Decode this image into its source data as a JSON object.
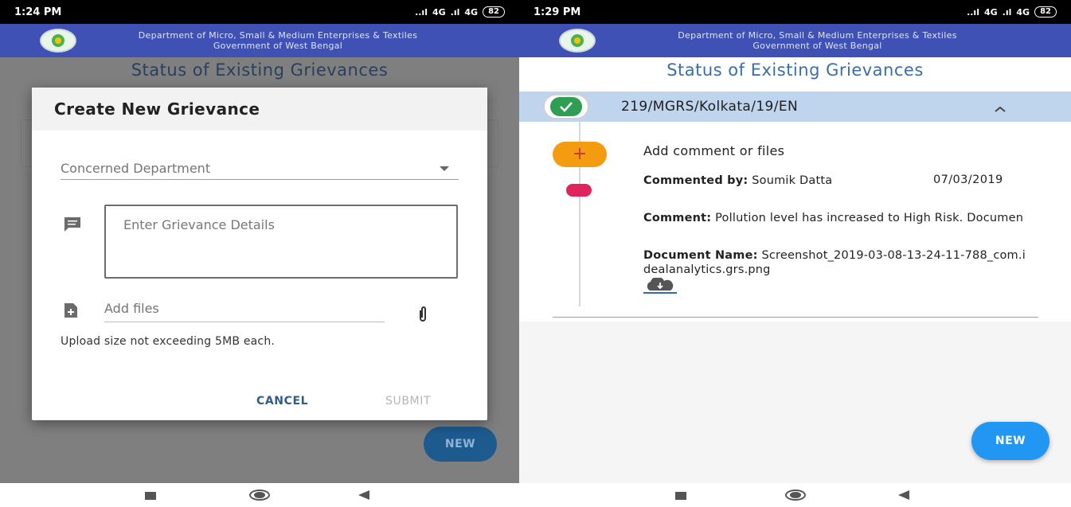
{
  "left": {
    "status_bar": {
      "time": "1:24 PM",
      "network": "4G",
      "battery": "82"
    },
    "header": {
      "line1": "Department of Micro, Small & Medium Enterprises & Textiles",
      "line2": "Government of West Bengal"
    },
    "screen_title": "Status of Existing Grievances",
    "dialog": {
      "title": "Create New Grievance",
      "department_placeholder": "Concerned Department",
      "details_placeholder": "Enter Grievance Details",
      "add_files_placeholder": "Add files",
      "upload_note": "Upload size not exceeding 5MB each.",
      "cancel_label": "CANCEL",
      "submit_label": "SUBMIT"
    },
    "fab_label": "NEW"
  },
  "right": {
    "status_bar": {
      "time": "1:29 PM",
      "network": "4G",
      "battery": "82"
    },
    "header": {
      "line1": "Department of Micro, Small & Medium Enterprises & Textiles",
      "line2": "Government of West Bengal"
    },
    "screen_title": "Status of Existing Grievances",
    "grievance": {
      "id": "219/MGRS/Kolkata/19/EN",
      "add_comment_label": "Add comment or files",
      "commented_by_label": "Commented by:",
      "commented_by_value": "Soumik Datta",
      "date": "07/03/2019",
      "comment_label": "Comment:",
      "comment_value": "Pollution level has increased to High Risk. Documen",
      "document_label": "Document Name:",
      "document_value": "Screenshot_2019-03-08-13-24-11-788_com.idealanalytics.grs.png"
    },
    "fab_label": "NEW"
  },
  "colors": {
    "app_bar": "#3f51b5",
    "fab": "#2196f3",
    "success": "#2e9e52",
    "accent_orange": "#f39c12",
    "status_red": "#e0245e"
  },
  "icons": [
    "emblem-logo",
    "comment-icon",
    "add-file-icon",
    "attach-icon",
    "dropdown-caret-icon",
    "check-icon",
    "chevron-up-icon",
    "plus-icon",
    "download-cloud-icon",
    "nav-recent-icon",
    "nav-home-icon",
    "nav-back-icon"
  ]
}
